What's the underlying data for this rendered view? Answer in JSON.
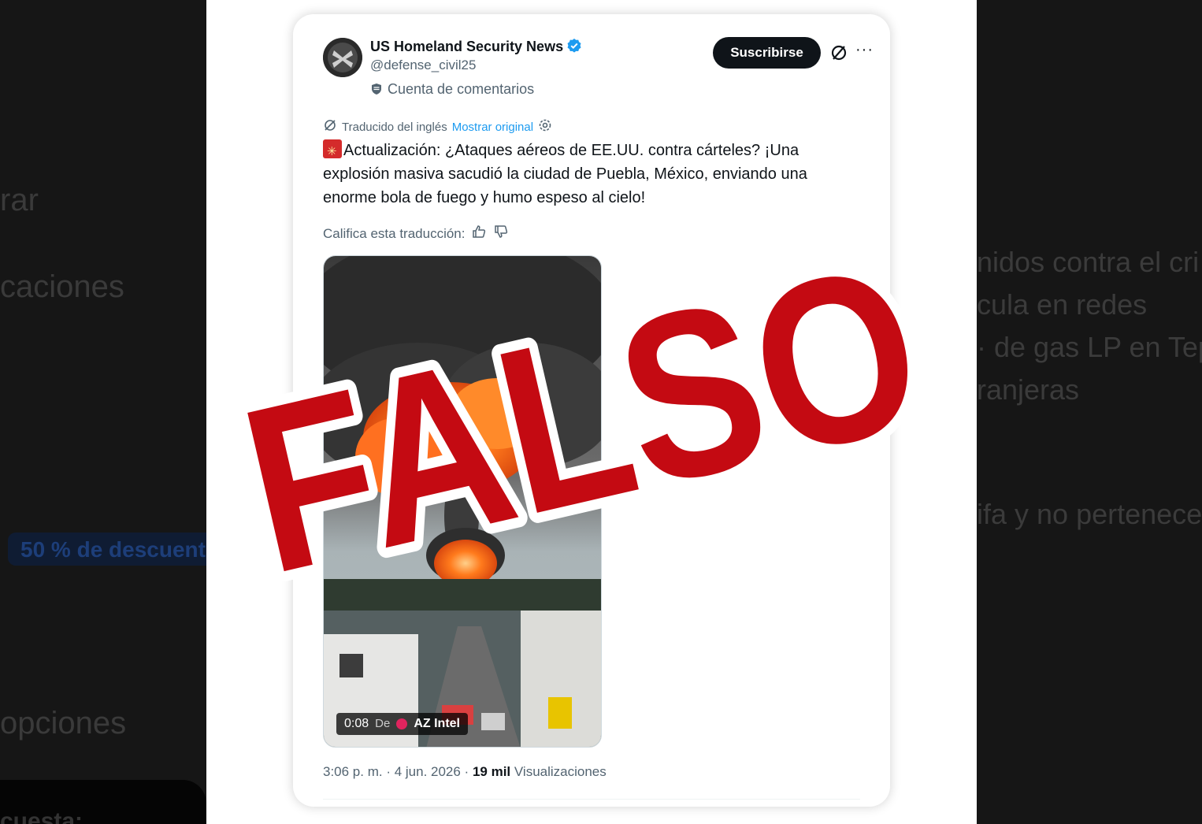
{
  "background": {
    "left_lines": [
      "rar",
      "caciones",
      "opciones"
    ],
    "left_pill": "50 % de descuento",
    "left_bottom": "cuesta:",
    "right_lines": [
      "nidos contra el cri",
      "cula en redes",
      "· de gas LP en Tep",
      "ranjeras",
      "ifa y no pertenece"
    ]
  },
  "post": {
    "account_name": "US Homeland Security News",
    "handle": "@defense_civil25",
    "account_label": "Cuenta de comentarios",
    "subscribe_label": "Suscribirse",
    "more_label": "···",
    "translated_from": "Traducido del inglés",
    "show_original": "Mostrar original",
    "text": "Actualización: ¿Ataques aéreos de EE.UU. contra cárteles? ¡Una explosión masiva sacudió la ciudad de Puebla, México, enviando una enorme bola de fuego y humo espeso al cielo!",
    "rate_label": "Califica esta traducción:",
    "video": {
      "duration": "0:08",
      "from_label": "De",
      "source": "AZ Intel"
    },
    "time": "3:06 p. m. · 4 jun. 2026 · ",
    "views_count": "19 mil",
    "views_label": " Visualizaciones"
  },
  "stamp": {
    "text": "FALSO",
    "color": "#c40a12"
  },
  "colors": {
    "link": "#1d9bf0",
    "verified": "#1d9bf0",
    "text": "#0f1419",
    "muted": "#536471"
  },
  "icons": [
    "verified-badge-icon",
    "shield-icon",
    "translate-icon",
    "settings-gear-icon",
    "thumbs-up-icon",
    "thumbs-down-icon",
    "siren-emoji-icon"
  ]
}
